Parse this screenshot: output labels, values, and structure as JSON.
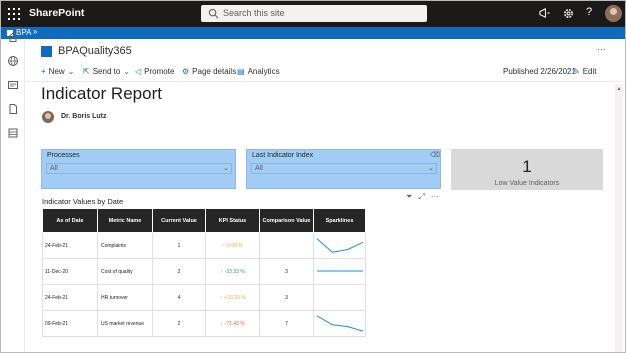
{
  "suite": {
    "app_name": "SharePoint",
    "search_placeholder": "Search this site",
    "help": "?"
  },
  "hub": {
    "label": "BPA"
  },
  "site": {
    "title": "BPAQuality365",
    "more": "···"
  },
  "commands": {
    "new": "New",
    "send_to": "Send to",
    "promote": "Promote",
    "page_details": "Page details",
    "analytics": "Analytics",
    "published": "Published 2/26/2021",
    "edit": "Edit"
  },
  "page": {
    "title": "Indicator Report",
    "author": "Dr. Boris Lutz"
  },
  "slicers": [
    {
      "title": "Processes",
      "value": "All"
    },
    {
      "title": "Last Indicator Index",
      "value": "All"
    }
  ],
  "card": {
    "value": "1",
    "label": "Low Value Indicators"
  },
  "table": {
    "title": "Indicator Values by Date",
    "columns": [
      "As of Date",
      "Metric Name",
      "Current Value",
      "KPI Status",
      "Comparison Value",
      "Sparklines"
    ],
    "rows": [
      {
        "date": "24-Feb-21",
        "metric": "Complaints",
        "current": "1",
        "kpi": "0.00 %",
        "kpi_icon": "○",
        "kpi_color": "#f2a541",
        "comparison": "",
        "spark": [
          0.15,
          0.9,
          0.75,
          0.35
        ]
      },
      {
        "date": "11-Dec-20",
        "metric": "Cost of quality",
        "current": "2",
        "kpi": "-33.33 %",
        "kpi_icon": "↑",
        "kpi_color": "#2e9e6b",
        "comparison": "3",
        "spark": [
          0.5,
          0.5,
          0.5,
          0.5
        ]
      },
      {
        "date": "24-Feb-21",
        "metric": "HR turnover",
        "current": "4",
        "kpi": "+33.33 %",
        "kpi_icon": "○",
        "kpi_color": "#f2a541",
        "comparison": "3",
        "spark": []
      },
      {
        "date": "09-Feb-21",
        "metric": "US market revenue",
        "current": "2",
        "kpi": "-71.43 %",
        "kpi_icon": "↓",
        "kpi_color": "#e0574f",
        "comparison": "7",
        "spark": [
          0.1,
          0.6,
          0.7,
          0.95
        ]
      }
    ]
  },
  "colors": {
    "suite_bg": "#1b1a19",
    "hub_bg": "#0f6cbd",
    "slicer_bg": "#a3ccf4",
    "card_bg": "#d9d9d9",
    "header_bg": "#262626",
    "spark_line": "#1f8fd6"
  }
}
